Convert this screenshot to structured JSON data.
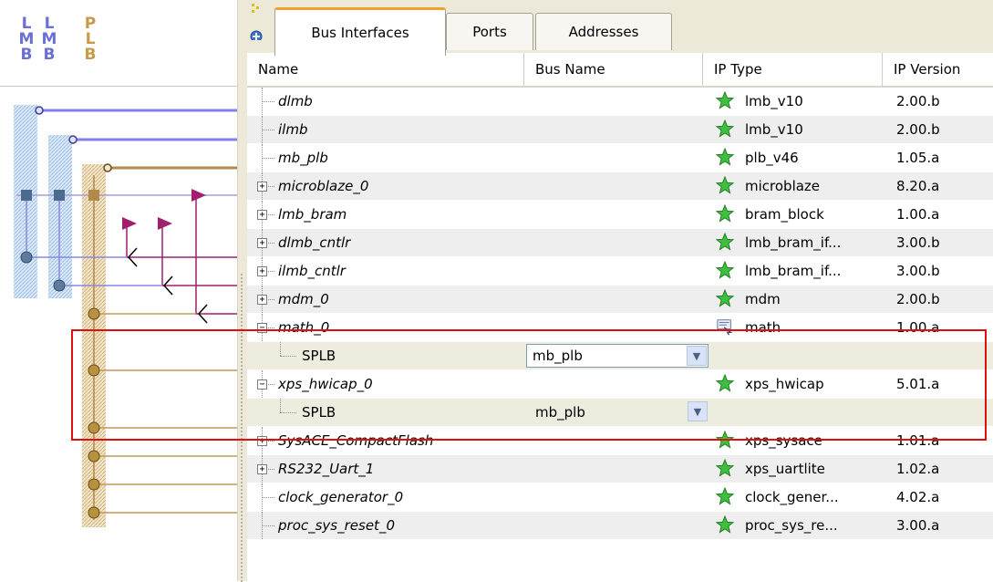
{
  "bus_labels": [
    {
      "letters": [
        "L",
        "M",
        "B"
      ],
      "color": "#6a70d6"
    },
    {
      "letters": [
        "L",
        "M",
        "B"
      ],
      "color": "#6a70d6"
    },
    {
      "letters": [
        "P",
        "L",
        "B"
      ],
      "color": "#c79a49"
    }
  ],
  "tabs": [
    {
      "label": "Bus Interfaces",
      "active": true
    },
    {
      "label": "Ports",
      "active": false
    },
    {
      "label": "Addresses",
      "active": false
    }
  ],
  "columns": [
    "Name",
    "Bus Name",
    "IP Type",
    "IP Version"
  ],
  "rows": [
    {
      "name": "dlmb",
      "bus": "",
      "ip_type": "lmb_v10",
      "version": "2.00.b",
      "icon": "green-star-icon",
      "expander": "none"
    },
    {
      "name": "ilmb",
      "bus": "",
      "ip_type": "lmb_v10",
      "version": "2.00.b",
      "icon": "green-star-icon",
      "expander": "none"
    },
    {
      "name": "mb_plb",
      "bus": "",
      "ip_type": "plb_v46",
      "version": "1.05.a",
      "icon": "green-star-icon",
      "expander": "none"
    },
    {
      "name": "microblaze_0",
      "bus": "",
      "ip_type": "microblaze",
      "version": "8.20.a",
      "icon": "green-star-icon",
      "expander": "plus"
    },
    {
      "name": "lmb_bram",
      "bus": "",
      "ip_type": "bram_block",
      "version": "1.00.a",
      "icon": "green-star-icon",
      "expander": "plus"
    },
    {
      "name": "dlmb_cntlr",
      "bus": "",
      "ip_type": "lmb_bram_if...",
      "version": "3.00.b",
      "icon": "green-star-icon",
      "expander": "plus"
    },
    {
      "name": "ilmb_cntlr",
      "bus": "",
      "ip_type": "lmb_bram_if...",
      "version": "3.00.b",
      "icon": "green-star-icon",
      "expander": "plus"
    },
    {
      "name": "mdm_0",
      "bus": "",
      "ip_type": "mdm",
      "version": "2.00.b",
      "icon": "green-star-icon",
      "expander": "plus"
    },
    {
      "name": "math_0",
      "bus": "",
      "ip_type": "math",
      "version": "1.00.a",
      "icon": "custom-ip-icon",
      "expander": "minus"
    },
    {
      "name": "SPLB",
      "bus": "mb_plb",
      "ip_type": "",
      "version": "",
      "icon": "",
      "expander": "child",
      "combo": "box"
    },
    {
      "name": "xps_hwicap_0",
      "bus": "",
      "ip_type": "xps_hwicap",
      "version": "5.01.a",
      "icon": "green-star-icon",
      "expander": "minus"
    },
    {
      "name": "SPLB",
      "bus": "mb_plb",
      "ip_type": "",
      "version": "",
      "icon": "",
      "expander": "child",
      "combo": "flat"
    },
    {
      "name": "SysACE_CompactFlash",
      "bus": "",
      "ip_type": "xps_sysace",
      "version": "1.01.a",
      "icon": "green-star-icon",
      "expander": "plus"
    },
    {
      "name": "RS232_Uart_1",
      "bus": "",
      "ip_type": "xps_uartlite",
      "version": "1.02.a",
      "icon": "green-star-icon",
      "expander": "plus"
    },
    {
      "name": "clock_generator_0",
      "bus": "",
      "ip_type": "clock_gener...",
      "version": "4.02.a",
      "icon": "green-star-icon",
      "expander": "none"
    },
    {
      "name": "proc_sys_reset_0",
      "bus": "",
      "ip_type": "proc_sys_re...",
      "version": "3.00.a",
      "icon": "green-star-icon",
      "expander": "none"
    }
  ],
  "colors": {
    "lmb_bus": "#8080ee",
    "plb_bus": "#c19a5a",
    "p2p_bus": "#a0206f",
    "highlight": "#e01010",
    "tab_accent": "#f0a030"
  }
}
